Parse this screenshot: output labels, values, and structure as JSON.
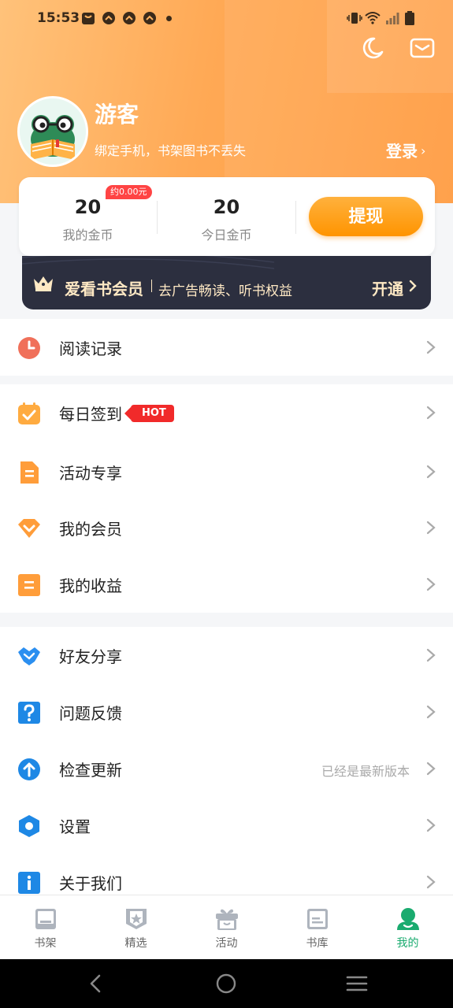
{
  "status_bar": {
    "time": "15:53"
  },
  "profile": {
    "username": "游客",
    "subtitle": "绑定手机，书架图书不丢失",
    "login_label": "登录",
    "login_chevron": "›"
  },
  "coins": {
    "my_coins_value": "20",
    "my_coins_label": "我的金币",
    "badge": "约0.00元",
    "today_value": "20",
    "today_label": "今日金币",
    "withdraw_label": "提现"
  },
  "vip": {
    "title": "爱看书会员",
    "subtitle": "去广告畅读、听书权益",
    "open_label": "开通"
  },
  "menu": {
    "reading_record": "阅读记录",
    "daily_checkin": "每日签到",
    "hot_badge": "HOT",
    "activities": "活动专享",
    "my_member": "我的会员",
    "my_earnings": "我的收益",
    "share": "好友分享",
    "feedback": "问题反馈",
    "check_update": "检查更新",
    "update_status": "已经是最新版本",
    "settings": "设置",
    "about": "关于我们"
  },
  "tabs": {
    "bookshelf": "书架",
    "featured": "精选",
    "activity": "活动",
    "library": "书库",
    "mine": "我的"
  },
  "colors": {
    "header_orange": "#ffa955",
    "withdraw_orange": "#ff9400",
    "vip_dark": "#2c2f3f",
    "vip_gold": "#ffe9c4",
    "active_tab_green": "#1aab6f",
    "hot_red": "#f12a2a"
  }
}
